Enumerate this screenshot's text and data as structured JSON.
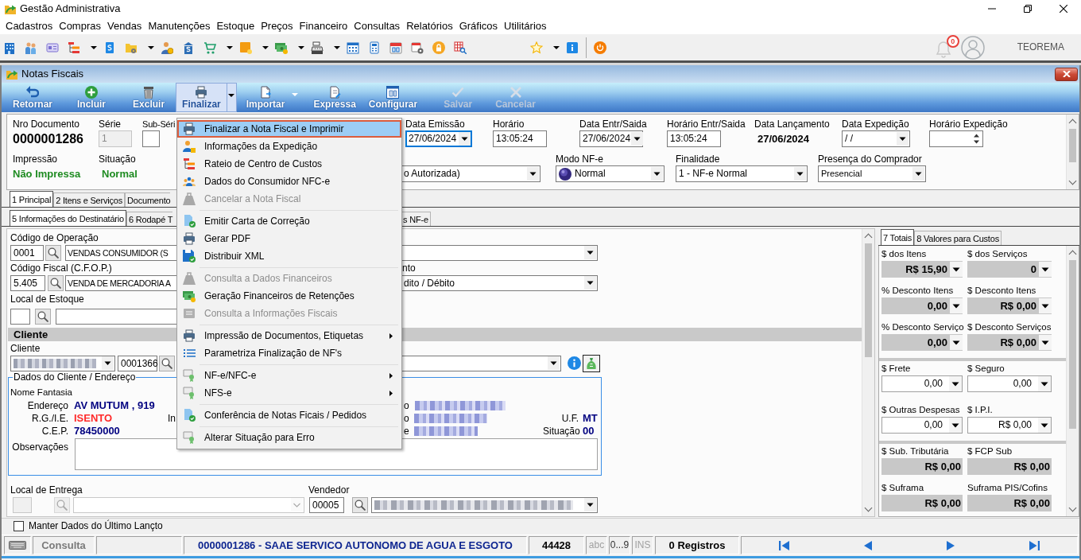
{
  "app": {
    "title": "Gestão Administrativa",
    "notifications": "0",
    "user": "TEOREMA"
  },
  "menu_bar": [
    "Cadastros",
    "Compras",
    "Vendas",
    "Manutenções",
    "Estoque",
    "Preços",
    "Financeiro",
    "Consultas",
    "Relatórios",
    "Gráficos",
    "Utilitários"
  ],
  "toolbar": [
    {
      "dropdown": false
    },
    {
      "dropdown": false
    },
    {
      "dropdown": false
    },
    {
      "dropdown": true
    },
    {
      "dropdown": false
    },
    {
      "dropdown": true
    },
    {
      "dropdown": false
    },
    {
      "dropdown": false
    },
    {
      "dropdown": true
    },
    {
      "dropdown": true
    },
    {
      "dropdown": true
    },
    {
      "dropdown": true
    },
    {
      "dropdown": false
    },
    {
      "dropdown": false
    },
    {
      "dropdown": false
    },
    {
      "dropdown": false
    },
    {
      "dropdown": false
    },
    {
      "dropdown": false
    },
    {
      "dropdown": true
    },
    {
      "dropdown": false
    },
    {
      "dropdown": false
    }
  ],
  "window": {
    "title": "Notas Fiscais"
  },
  "ribbon": [
    {
      "label": "Retornar",
      "pressed": false,
      "disabled": false,
      "dropdown": false
    },
    {
      "label": "Incluir",
      "pressed": false,
      "disabled": false,
      "dropdown": false
    },
    {
      "label": "Excluir",
      "pressed": false,
      "disabled": false,
      "dropdown": false
    },
    {
      "label": "Finalizar",
      "pressed": true,
      "disabled": false,
      "dropdown": true
    },
    {
      "label": "Importar",
      "pressed": false,
      "disabled": false,
      "dropdown": true
    },
    {
      "label": "Expressa",
      "pressed": false,
      "disabled": false,
      "dropdown": false
    },
    {
      "label": "Configurar",
      "pressed": false,
      "disabled": false,
      "dropdown": false
    },
    {
      "label": "Salvar",
      "pressed": false,
      "disabled": true,
      "dropdown": false
    },
    {
      "label": "Cancelar",
      "pressed": false,
      "disabled": true,
      "dropdown": false
    }
  ],
  "header": {
    "nro_documento": {
      "label": "Nro Documento",
      "value": "0000001286"
    },
    "serie": {
      "label": "Série",
      "value": "1",
      "disabled": true
    },
    "sub_serie": {
      "label": "Sub-Séri"
    },
    "data_emissao": {
      "label": "Data Emissão",
      "value": "27/06/2024",
      "focused": true
    },
    "horario": {
      "label": "Horário",
      "value": "13:05:24"
    },
    "data_entr_saida": {
      "label": "Data Entr/Saida",
      "value": "27/06/2024"
    },
    "horario_entr_saida": {
      "label": "Horário Entr/Saida",
      "value": "13:05:24"
    },
    "data_lancamento": {
      "label": "Data Lançamento",
      "value": "27/06/2024"
    },
    "data_expedicao": {
      "label": "Data Expedição",
      "value": "/ /"
    },
    "horario_expedicao": {
      "label": "Horário Expedição"
    },
    "impressao": {
      "label": "Impressão",
      "value": "Não Impressa"
    },
    "situacao": {
      "label": "Situação",
      "value": "Normal"
    },
    "status_combo": {
      "value": "o Autorizada)"
    },
    "modo_nfe": {
      "label": "Modo NF-e",
      "value": "Normal"
    },
    "finalidade": {
      "label": "Finalidade",
      "value": "1 - NF-e Normal"
    },
    "presenca": {
      "label": "Presença do Comprador",
      "value": "Presencial"
    }
  },
  "tabs_main": [
    {
      "label": "1 Principal",
      "selected": true
    },
    {
      "label": "2 Itens e Serviços",
      "selected": false
    },
    {
      "label": "Documento",
      "selected": false
    }
  ],
  "tabs_detail": [
    {
      "label": "5 Informações do Destinatário",
      "selected": true
    },
    {
      "label": "6 Rodapé T",
      "selected": false
    },
    {
      "label": "s NF-e",
      "selected": false
    }
  ],
  "form": {
    "operacao": {
      "label": "Código de Operação",
      "code": "0001",
      "description": "VENDAS CONSUMIDOR (S"
    },
    "cfop": {
      "label": "Código Fiscal (C.F.O.P.)",
      "code": "5.405",
      "description": "VENDA DE MERCADORIA A"
    },
    "pagamento": {
      "label": "nto",
      "value": "dito / Débito"
    },
    "local_estoque": {
      "label": "Local de Estoque"
    },
    "cliente": {
      "title": "Cliente",
      "label": "Cliente",
      "code": "0001366"
    },
    "dados_cliente": {
      "title": "Dados do Cliente / Endereço",
      "nome_fantasia_label": "Nome Fantasia",
      "rows": [
        {
          "label": "Endereço",
          "value": "AV MUTUM , 919",
          "color": "#000080",
          "side_label": "o"
        },
        {
          "label": "R.G./I.E.",
          "value": "ISENTO",
          "color": "#ff2a2a",
          "inner_label": "In",
          "side_label": "o",
          "extra_label": "U.F.",
          "extra_value": "MT"
        },
        {
          "label": "C.E.P.",
          "value": "78450000",
          "color": "#000080",
          "side_label": "e",
          "extra_label": "Situação",
          "extra_value": "00"
        }
      ],
      "observacoes_label": "Observações"
    },
    "local_entrega": {
      "label": "Local de Entrega"
    },
    "vendedor": {
      "label": "Vendedor",
      "code": "00005"
    }
  },
  "totals": {
    "tabs": [
      {
        "label": "7 Totais",
        "selected": true
      },
      {
        "label": "8 Valores para Custos",
        "selected": false
      }
    ],
    "groups": [
      [
        {
          "label": "$ dos Itens",
          "value": "R$ 15,90",
          "kind": "readonly_combo"
        },
        {
          "label": "$ dos Serviços",
          "value": "0",
          "kind": "readonly_combo"
        },
        {
          "label": "% Desconto Itens",
          "value": "0,00",
          "kind": "readonly_combo"
        },
        {
          "label": "$ Desconto Itens",
          "value": "R$ 0,00",
          "kind": "readonly_combo"
        },
        {
          "label": "% Desconto Serviço",
          "value": "0,00",
          "kind": "readonly_combo"
        },
        {
          "label": "$ Desconto Serviços",
          "value": "R$ 0,00",
          "kind": "readonly_combo"
        }
      ],
      [
        {
          "label": "$ Frete",
          "value": "0,00",
          "kind": "combo"
        },
        {
          "label": "$ Seguro",
          "value": "0,00",
          "kind": "combo"
        },
        {
          "label": "$ Outras Despesas",
          "value": "0,00",
          "kind": "combo"
        },
        {
          "label": "$ I.P.I.",
          "value": "R$ 0,00",
          "kind": "combo"
        }
      ],
      [
        {
          "label": "$ Sub. Tributária",
          "value": "R$ 0,00",
          "kind": "readonly"
        },
        {
          "label": "$ FCP Sub",
          "value": "R$ 0,00",
          "kind": "readonly"
        },
        {
          "label": "$ Suframa",
          "value": "R$ 0,00",
          "kind": "readonly"
        },
        {
          "label": "Suframa PIS/Cofins",
          "value": "R$ 0,00",
          "kind": "readonly"
        }
      ]
    ]
  },
  "keep_last": {
    "label": "Manter Dados do Último Lançto",
    "checked": false
  },
  "status_bar": {
    "mode": "Consulta",
    "document": "0000001286 - SAAE SERVICO AUTONOMO DE AGUA E ESGOTO",
    "code": "44428",
    "indicators": [
      {
        "label": "abc",
        "active": false
      },
      {
        "label": "0...9",
        "active": true
      },
      {
        "label": "INS",
        "active": false
      }
    ],
    "records": "0 Registros"
  },
  "context_menu": [
    [
      {
        "label": "Finalizar a Nota Fiscal e Imprimir",
        "selected": true,
        "disabled": false,
        "submenu": false
      },
      {
        "label": "Informações da Expedição",
        "selected": false,
        "disabled": false,
        "submenu": false
      },
      {
        "label": "Rateio de Centro de Custos",
        "selected": false,
        "disabled": false,
        "submenu": false
      },
      {
        "label": "Dados do Consumidor NFC-e",
        "selected": false,
        "disabled": false,
        "submenu": false
      },
      {
        "label": "Cancelar a Nota Fiscal",
        "selected": false,
        "disabled": true,
        "submenu": false
      }
    ],
    [
      {
        "label": "Emitir Carta de Correção",
        "selected": false,
        "disabled": false,
        "submenu": false
      },
      {
        "label": "Gerar PDF",
        "selected": false,
        "disabled": false,
        "submenu": false
      },
      {
        "label": "Distribuir XML",
        "selected": false,
        "disabled": false,
        "submenu": false
      }
    ],
    [
      {
        "label": "Consulta a Dados Financeiros",
        "selected": false,
        "disabled": true,
        "submenu": false
      },
      {
        "label": "Geração Financeiros de Retenções",
        "selected": false,
        "disabled": false,
        "submenu": false
      },
      {
        "label": "Consulta a Informações Fiscais",
        "selected": false,
        "disabled": true,
        "submenu": false
      }
    ],
    [
      {
        "label": "Impressão de Documentos, Etiquetas",
        "selected": false,
        "disabled": false,
        "submenu": true
      },
      {
        "label": "Parametriza Finalização de NF's",
        "selected": false,
        "disabled": false,
        "submenu": false
      }
    ],
    [
      {
        "label": "NF-e/NFC-e",
        "selected": false,
        "disabled": false,
        "submenu": true
      },
      {
        "label": "NFS-e",
        "selected": false,
        "disabled": false,
        "submenu": true
      }
    ],
    [
      {
        "label": "Conferência de Notas Ficais / Pedidos",
        "selected": false,
        "disabled": false,
        "submenu": false
      }
    ],
    [
      {
        "label": "Alterar Situação para Erro",
        "selected": false,
        "disabled": false,
        "submenu": false
      }
    ]
  ]
}
